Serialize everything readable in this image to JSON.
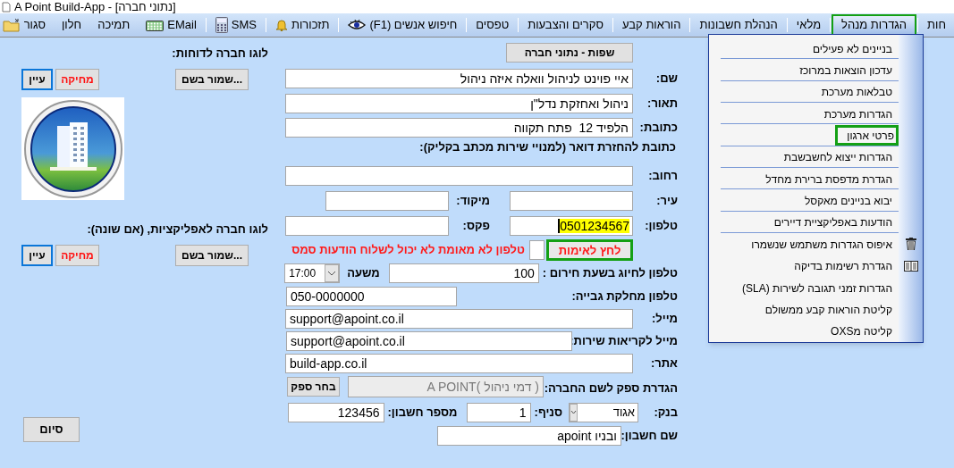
{
  "window": {
    "title": "A Point Build-App - [נתוני חברה]"
  },
  "menu_bar": [
    {
      "label": "חות",
      "selected": false,
      "separator": true
    },
    {
      "label": "הגדרות מנהל",
      "selected": true,
      "separator": true
    },
    {
      "label": "מלאי",
      "selected": false,
      "separator": true
    },
    {
      "label": "הנהלת חשבונות",
      "selected": false,
      "separator": true
    },
    {
      "label": "הוראות קבע",
      "selected": false,
      "separator": true
    },
    {
      "label": "סקרים והצבעות",
      "selected": false,
      "separator": true
    },
    {
      "label": "טפסים",
      "selected": false,
      "separator": true
    },
    {
      "label": "חיפוש אנשים (F1)",
      "selected": false,
      "separator": true
    },
    {
      "label": "תזכורות",
      "selected": false,
      "separator": true
    },
    {
      "label": "SMS",
      "selected": false,
      "separator": true
    },
    {
      "label": "EMail",
      "selected": false,
      "separator": false
    },
    {
      "label": "תמיכה",
      "selected": false,
      "separator": false
    },
    {
      "label": "חלון",
      "selected": false,
      "separator": false
    },
    {
      "label": "סגור",
      "selected": false,
      "separator": false
    }
  ],
  "dropdown": {
    "items": [
      {
        "label": "בניינים לא פעילים",
        "highlighted": false,
        "separator": true
      },
      {
        "label": "עדכון הוצאות במרוכז",
        "highlighted": false,
        "separator": true
      },
      {
        "label": "טבלאות מערכת",
        "highlighted": false,
        "separator": true
      },
      {
        "label": "הגדרות מערכת",
        "highlighted": false,
        "separator": true
      },
      {
        "label": "פרטי ארגון",
        "highlighted": true,
        "separator": true
      },
      {
        "label": "הגדרות ייצוא לחשבשבת",
        "highlighted": false,
        "separator": true
      },
      {
        "label": "הגדרת מדפסת ברירת מחדל",
        "highlighted": false,
        "separator": true
      },
      {
        "label": "יבוא בניינים מאקסל",
        "highlighted": false,
        "separator": true
      },
      {
        "label": "הודעות באפליקציית דיירים",
        "highlighted": false,
        "separator": true
      },
      {
        "label": "איפוס הגדרות משתמש שנשמרו",
        "highlighted": false,
        "separator": false
      },
      {
        "label": "הגדרת רשימות בדיקה",
        "highlighted": false,
        "separator": false
      },
      {
        "label": "הגדרות זמני תגובה לשירות (SLA)",
        "highlighted": false,
        "separator": false
      },
      {
        "label": "קליטת הוראות קבע ממשולם",
        "highlighted": false,
        "separator": false
      },
      {
        "label": "קליטה מOXS",
        "highlighted": false,
        "separator": false
      }
    ]
  },
  "logos": [
    {
      "label": "לוגו חברה לדוחות:",
      "save_button": "שמור בשם...",
      "delete_button": "מחיקה",
      "browse_button": "עיין",
      "has_image": true
    },
    {
      "label": "לוגו חברה לאפליקציות, (אם שונה):",
      "save_button": "שמור בשם...",
      "delete_button": "מחיקה",
      "browse_button": "עיין",
      "has_image": false
    }
  ],
  "finish_button": "סיום",
  "company": {
    "languages_button": "שפות - נתוני חברה",
    "name": {
      "label": "שם:",
      "value": "איי פוינט לניהול וואלה איזה ניהול"
    },
    "description": {
      "label": "תאור:",
      "value": "ניהול ואחזקת נדל\"ן"
    },
    "address": {
      "label": "כתובת:",
      "value": "הלפיד 12  פתח תקווה"
    },
    "mail_heading": "כתובת להחזרת דואר (למנויי שירות מכתב בקליק):",
    "street": {
      "label": "רחוב:"
    },
    "city": {
      "label": "עיר:"
    },
    "zip": {
      "label": "מיקוד:"
    },
    "phone": {
      "label": "טלפון:",
      "value": "0501234567",
      "selected": true
    },
    "fax": {
      "label": "פקס:"
    },
    "verify_button": {
      "label": "לחץ לאימות",
      "highlighted": true
    },
    "verify_warning": "טלפון לא מאומת לא יכול לשלוח הודעות סמס",
    "emergency_phone": {
      "label": "טלפון לחיוג בשעת חירום :",
      "value": "100"
    },
    "from_hour": {
      "label": "משעה",
      "value": "17:00"
    },
    "billing_phone": {
      "label": "טלפון מחלקת גבייה:",
      "value": "050-0000000"
    },
    "email": {
      "label": "מייל:",
      "value": "support@apoint.co.il"
    },
    "service_email": {
      "label": "מייל לקריאות שירות:",
      "value": "support@apoint.co.il"
    },
    "website": {
      "label": "אתר:",
      "value": "build-app.co.il"
    },
    "supplier": {
      "label": "הגדרת ספק לשם החברה:",
      "value": "( דמי ניהול )A POINT",
      "disabled": true,
      "button": "בחר ספק"
    },
    "bank": {
      "label": "בנק:",
      "value": "אגוד"
    },
    "branch": {
      "label": "סניף:",
      "value": "1"
    },
    "account_number": {
      "label": "מספר חשבון:",
      "value": "123456"
    },
    "account_name": {
      "label": "שם חשבון:",
      "value": "ובניו apoint"
    }
  }
}
